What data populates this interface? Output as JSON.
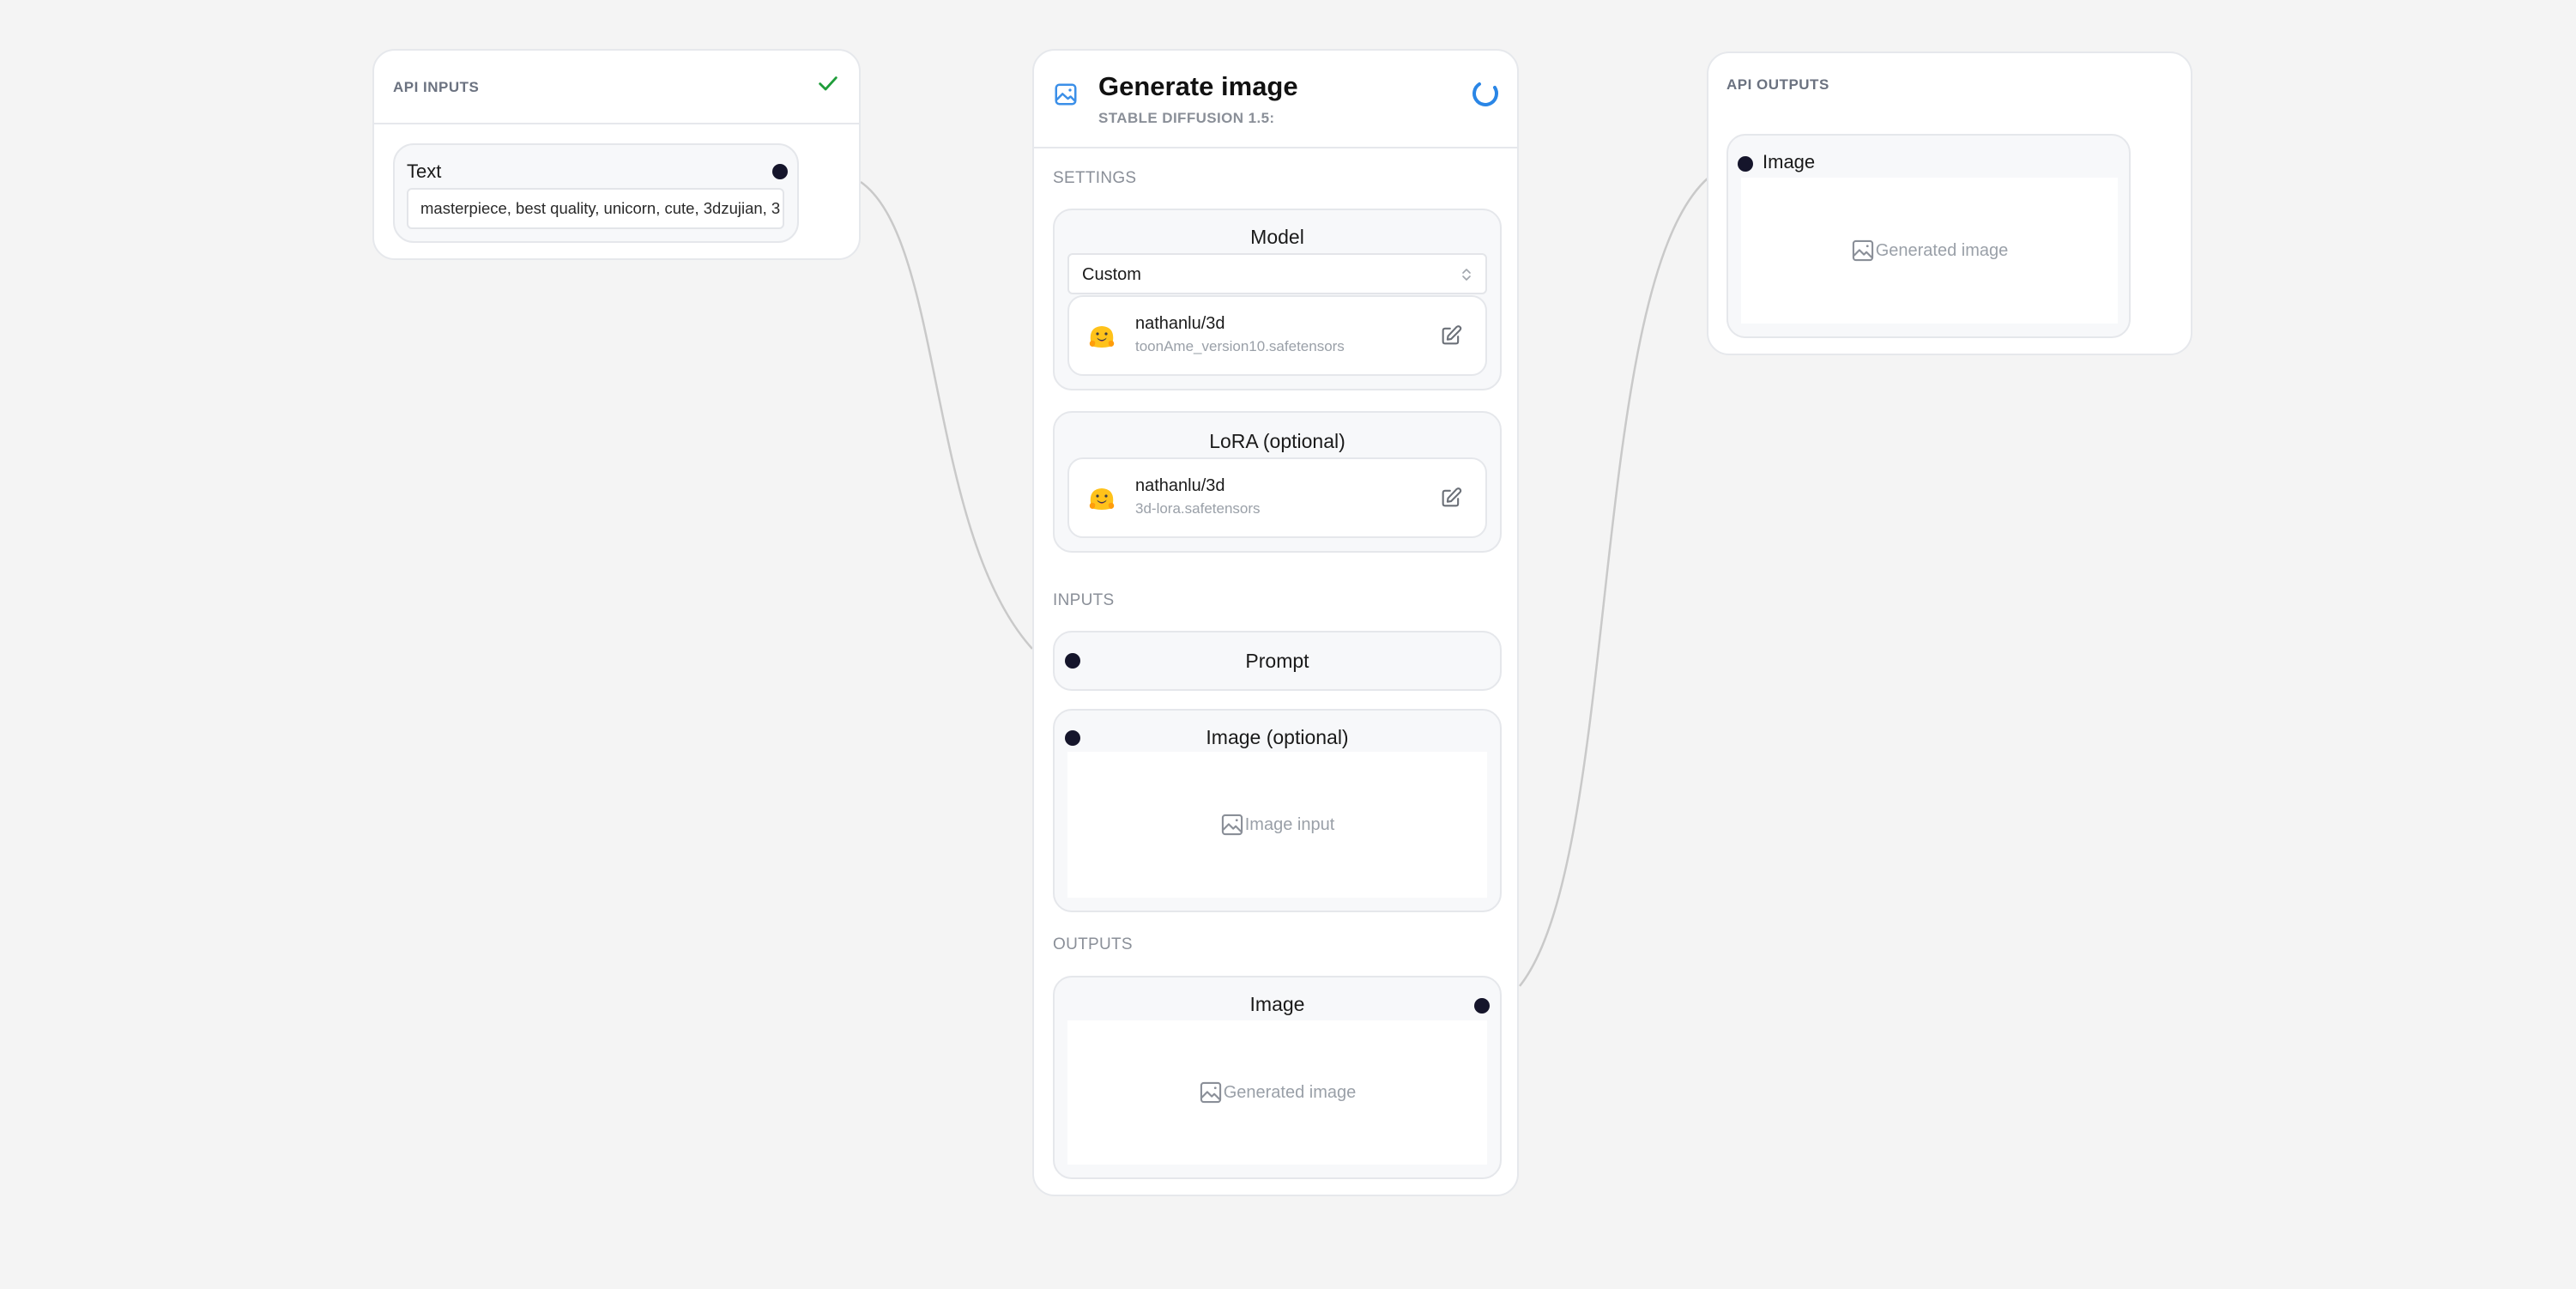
{
  "api_inputs": {
    "title": "API INPUTS",
    "status_icon": "check-icon",
    "status_color": "#1f9d3a",
    "fields": [
      {
        "label": "Text",
        "value": "masterpiece, best quality, unicorn, cute, 3dzujian, 3"
      }
    ]
  },
  "generate_node": {
    "icon": "image-icon",
    "icon_color": "#3b8fe8",
    "title": "Generate image",
    "subtitle": "STABLE DIFFUSION 1.5:",
    "status_icon": "spinner-icon",
    "status_color": "#2a86e6",
    "settings_label": "SETTINGS",
    "model": {
      "title": "Model",
      "select_value": "Custom",
      "repo": "nathanlu/3d",
      "file": "toonAme_version10.safetensors"
    },
    "lora": {
      "title": "LoRA (optional)",
      "repo": "nathanlu/3d",
      "file": "3d-lora.safetensors"
    },
    "inputs_label": "INPUTS",
    "prompt_label": "Prompt",
    "image_input": {
      "title": "Image (optional)",
      "placeholder": "Image input"
    },
    "outputs_label": "OUTPUTS",
    "image_output": {
      "title": "Image",
      "placeholder": "Generated image"
    }
  },
  "api_outputs": {
    "title": "API OUTPUTS",
    "fields": [
      {
        "label": "Image",
        "placeholder": "Generated image"
      }
    ]
  }
}
